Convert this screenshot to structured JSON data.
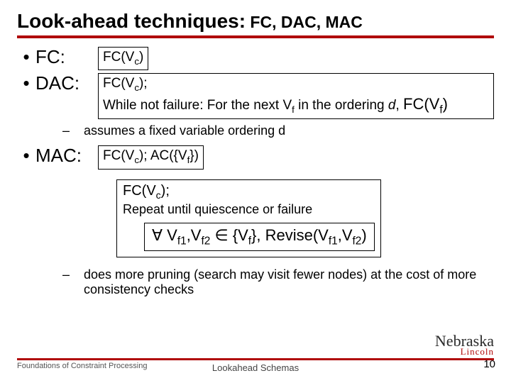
{
  "title_main": "Look-ahead techniques:",
  "title_sub": " FC, DAC, MAC",
  "items": {
    "fc": {
      "label": "FC:",
      "box": "FC(V<sub>c</sub>)"
    },
    "dac": {
      "label": "DAC:",
      "box": "FC(V<sub>c</sub>);<br>While not failure: For the next V<sub>f</sub> in the ordering <span class=\"italic\">d</span>, <span style=\"font-size:22px\">FC(V<sub>f</sub>)</span>",
      "note": "assumes a fixed variable ordering d"
    },
    "mac": {
      "label": "MAC:",
      "box": "FC(V<sub>c</sub>); AC({V<sub>f</sub>})",
      "detail_head": "FC(V<sub>c</sub>);",
      "detail_text": "Repeat until quiescence or failure",
      "detail_inner": "∀ V<sub>f</sub><sub>1</sub>,V<sub>f</sub><sub>2</sub> ∈ {V<sub>f</sub>}, Revise(V<sub>f</sub><sub>1</sub>,V<sub>f</sub><sub>2</sub>)",
      "note": "does more pruning (search may visit fewer nodes) at the cost of more consistency checks"
    }
  },
  "footer": {
    "left": "Foundations of Constraint Processing",
    "center": "Lookahead Schemas",
    "page": "10",
    "logo_top": "Nebraska",
    "logo_bottom": "Lincoln"
  }
}
